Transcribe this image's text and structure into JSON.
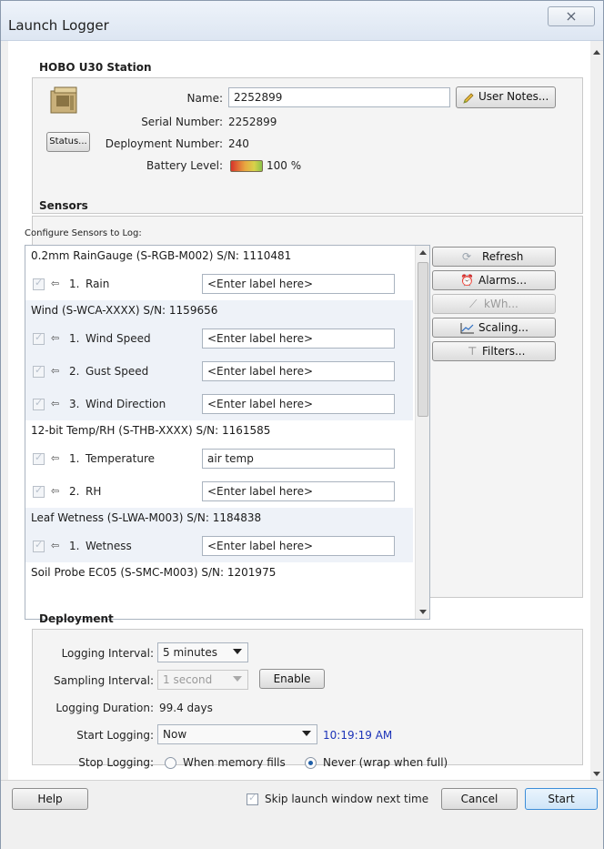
{
  "window": {
    "title": "Launch Logger",
    "close_glyph": "⨯"
  },
  "station": {
    "section_title": "HOBO U30 Station",
    "status_button": "Status...",
    "name_label": "Name:",
    "name_value": "2252899",
    "user_notes_button": "User Notes...",
    "serial_label": "Serial Number:",
    "serial_value": "2252899",
    "deployment_label": "Deployment Number:",
    "deployment_value": "240",
    "battery_label": "Battery Level:",
    "battery_value": "100 %",
    "battery_level_fraction": 1.0
  },
  "sensors": {
    "section_title": "Sensors",
    "configure_label": "Configure Sensors to Log:",
    "groups": [
      {
        "header": "0.2mm RainGauge (S-RGB-M002) S/N: 1110481",
        "rows": [
          {
            "index": "1.",
            "name": "Rain",
            "label": "<Enter label here>"
          }
        ]
      },
      {
        "header": "Wind (S-WCA-XXXX) S/N: 1159656",
        "rows": [
          {
            "index": "1.",
            "name": "Wind Speed",
            "label": "<Enter label here>"
          },
          {
            "index": "2.",
            "name": "Gust Speed",
            "label": "<Enter label here>"
          },
          {
            "index": "3.",
            "name": "Wind Direction",
            "label": "<Enter label here>"
          }
        ]
      },
      {
        "header": "12-bit Temp/RH (S-THB-XXXX) S/N: 1161585",
        "rows": [
          {
            "index": "1.",
            "name": "Temperature",
            "label": "air temp"
          },
          {
            "index": "2.",
            "name": "RH",
            "label": "<Enter label here>"
          }
        ]
      },
      {
        "header": "Leaf Wetness (S-LWA-M003) S/N: 1184838",
        "rows": [
          {
            "index": "1.",
            "name": "Wetness",
            "label": "<Enter label here>"
          }
        ]
      },
      {
        "header": "Soil Probe EC05 (S-SMC-M003) S/N: 1201975",
        "rows": []
      }
    ],
    "buttons": {
      "refresh": "Refresh",
      "alarms": "Alarms...",
      "kwh": "kWh...",
      "scaling": "Scaling...",
      "filters": "Filters..."
    }
  },
  "deployment": {
    "section_title": "Deployment",
    "logging_interval_label": "Logging Interval:",
    "logging_interval_value": "5 minutes",
    "sampling_interval_label": "Sampling Interval:",
    "sampling_interval_value": "1 second",
    "enable_button": "Enable",
    "logging_duration_label": "Logging Duration:",
    "logging_duration_value": "99.4 days",
    "start_logging_label": "Start Logging:",
    "start_logging_value": "Now",
    "start_time": "10:19:19 AM",
    "stop_logging_label": "Stop Logging:",
    "stop_option_memory": "When memory fills",
    "stop_option_never": "Never (wrap when full)",
    "stop_selected": "never"
  },
  "footer": {
    "help_button": "Help",
    "skip_label": "Skip launch window next time",
    "cancel_button": "Cancel",
    "start_button": "Start"
  },
  "colors": {
    "accent_time": "#1c33b8",
    "window_border": "#8a99ad"
  },
  "icons": [
    "logger-device-icon",
    "user-notes-pencil-icon",
    "battery-icon",
    "plug-icon",
    "refresh-icon",
    "alarm-clock-icon",
    "kwh-icon",
    "scaling-chart-icon",
    "filter-funnel-icon"
  ]
}
